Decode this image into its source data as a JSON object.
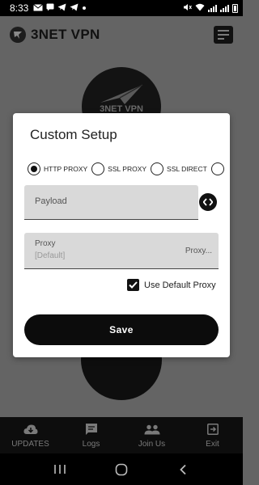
{
  "status_bar": {
    "time": "8:33",
    "left_icons": [
      "mail-icon",
      "message-icon",
      "telegram-icon",
      "telegram-icon",
      "dot-icon"
    ],
    "right_icons": [
      "mute-icon",
      "wifi-icon",
      "signal-icon",
      "signal-icon",
      "battery-icon"
    ]
  },
  "app": {
    "title": "3NET VPN",
    "logo_text": "3NET VPN"
  },
  "dialog": {
    "title": "Custom Setup",
    "modes": [
      {
        "label": "HTTP PROXY",
        "selected": true
      },
      {
        "label": "SSL PROXY",
        "selected": false
      },
      {
        "label": "SSL DIRECT",
        "selected": false
      },
      {
        "label": "",
        "selected": false
      }
    ],
    "payload": {
      "placeholder": "Payload",
      "value": ""
    },
    "proxy": {
      "label": "Proxy",
      "value": "[Default]",
      "button_label": "Proxy..."
    },
    "use_default_proxy": {
      "label": "Use Default Proxy",
      "checked": true
    },
    "save_label": "Save"
  },
  "bottom_nav": {
    "items": [
      {
        "label": "UPDATES",
        "icon": "cloud-download-icon"
      },
      {
        "label": "Logs",
        "icon": "chat-icon"
      },
      {
        "label": "Join Us",
        "icon": "group-icon"
      },
      {
        "label": "Exit",
        "icon": "exit-icon"
      }
    ]
  },
  "colors": {
    "overlay": "#646464",
    "dialog_bg": "#ffffff",
    "field_bg": "#d9d9d9",
    "primary": "#0c0c0c"
  }
}
